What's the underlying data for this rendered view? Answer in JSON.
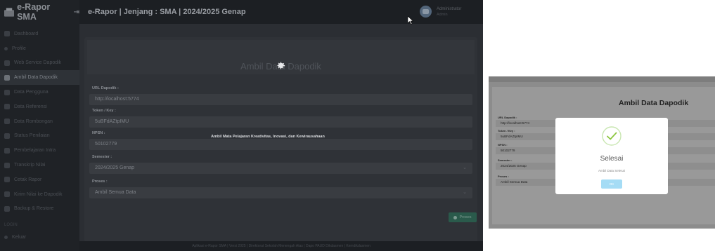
{
  "app": {
    "brand": "e-Rapor SMA",
    "header_title": "e-Rapor | Jenjang : SMA | 2024/2025 Genap",
    "user_name": "Administrator",
    "user_role": "Admin"
  },
  "sidebar": {
    "items": [
      {
        "label": "Dashboard",
        "icon": "dashboard-icon"
      },
      {
        "label": "Profile",
        "icon": "dot-icon"
      },
      {
        "label": "Web Service Dapodik",
        "icon": "settings-icon"
      },
      {
        "label": "Ambil Data Dapodik",
        "icon": "database-icon"
      },
      {
        "label": "Data Pengguna",
        "icon": "users-icon"
      },
      {
        "label": "Data Referensi",
        "icon": "folder-icon"
      },
      {
        "label": "Data Rombongan",
        "icon": "list-icon"
      },
      {
        "label": "Status Penilaian",
        "icon": "check-icon"
      },
      {
        "label": "Pembelajaran Intra",
        "icon": "book-icon"
      },
      {
        "label": "Transkrip Nilai",
        "icon": "file-icon"
      },
      {
        "label": "Cetak Rapor",
        "icon": "print-icon"
      },
      {
        "label": "Kirim Nilai ke Dapodik",
        "icon": "upload-icon"
      },
      {
        "label": "Backup & Restore",
        "icon": "archive-icon"
      }
    ],
    "section": "LOGIN",
    "logout": "Keluar"
  },
  "form": {
    "title": "Ambil Data Dapodik",
    "url_label": "URL Dapodik :",
    "url_value": "http://localhost:5774",
    "token_label": "Token / Key :",
    "token_value": "5uBFdAZtpIMU",
    "npsn_label": "NPSN :",
    "npsn_value": "50102779",
    "semester_label": "Semester :",
    "semester_value": "2024/2025 Genap",
    "proses_label": "Proses :",
    "proses_value": "Ambil Semua Data",
    "button_label": "Proses",
    "loading_message": "Ambil Mata Pelajaran Kreativitas, Inovasi, dan Kewirausahaan"
  },
  "footer": "Aplikasi e-Rapor SMA | Versi 2025 | Direktorat Sekolah Menengah Atas | Dapo PAUD Dikdasmen | Kemdikdasmen",
  "modal": {
    "title": "Selesai",
    "subtitle": "Ambil Data Selesai",
    "ok_label": "OK"
  }
}
